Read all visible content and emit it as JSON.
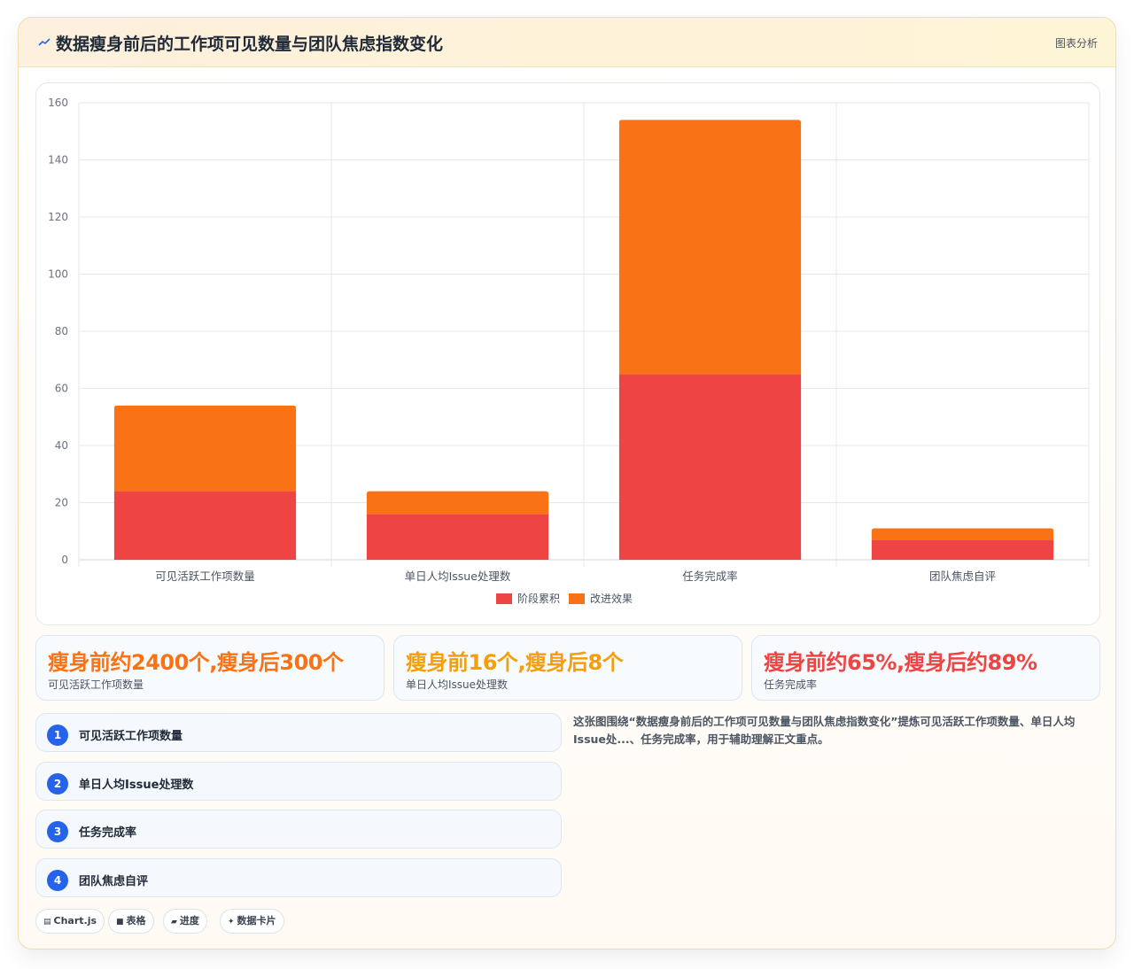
{
  "header": {
    "title": "数据瘦身前后的工作项可见数量与团队焦虑指数变化",
    "link": "图表分析"
  },
  "colors": {
    "series1": "#ef4444",
    "series2": "#f97316",
    "badge": "#2563eb",
    "kpi1": "#f97316",
    "kpi2": "#f59e0b",
    "kpi3": "#ef4444"
  },
  "chart_data": {
    "type": "bar",
    "stacked": true,
    "categories": [
      "可见活跃工作项数量",
      "单日人均Issue处理数",
      "任务完成率",
      "团队焦虑自评"
    ],
    "series": [
      {
        "name": "阶段累积",
        "values": [
          24,
          16,
          65,
          7
        ]
      },
      {
        "name": "改进效果",
        "values": [
          30,
          8,
          89,
          4
        ]
      }
    ],
    "ylim": [
      0,
      160
    ],
    "yticks": [
      "0",
      "20",
      "40",
      "60",
      "80",
      "100",
      "120",
      "140",
      "160"
    ],
    "grid": true,
    "legend_position": "bottom"
  },
  "kpis": [
    {
      "value": "瘦身前约2400个,瘦身后300个",
      "label": "可见活跃工作项数量"
    },
    {
      "value": "瘦身前16个,瘦身后8个",
      "label": "单日人均Issue处理数"
    },
    {
      "value": "瘦身前约65%,瘦身后约89%",
      "label": "任务完成率"
    }
  ],
  "list": [
    {
      "num": "1",
      "label": "可见活跃工作项数量"
    },
    {
      "num": "2",
      "label": "单日人均Issue处理数"
    },
    {
      "num": "3",
      "label": "任务完成率"
    },
    {
      "num": "4",
      "label": "团队焦虑自评"
    }
  ],
  "description": "这张图围绕“数据瘦身前后的工作项可见数量与团队焦虑指数变化”提炼可见活跃工作项数量、单日人均Issue处...、任务完成率，用于辅助理解正文重点。",
  "tags": [
    {
      "icon": "▤",
      "label": "Chart.js"
    },
    {
      "icon": "■",
      "label": "表格"
    },
    {
      "icon": "▰",
      "label": "进度"
    },
    {
      "icon": "✦",
      "label": "数据卡片"
    }
  ]
}
